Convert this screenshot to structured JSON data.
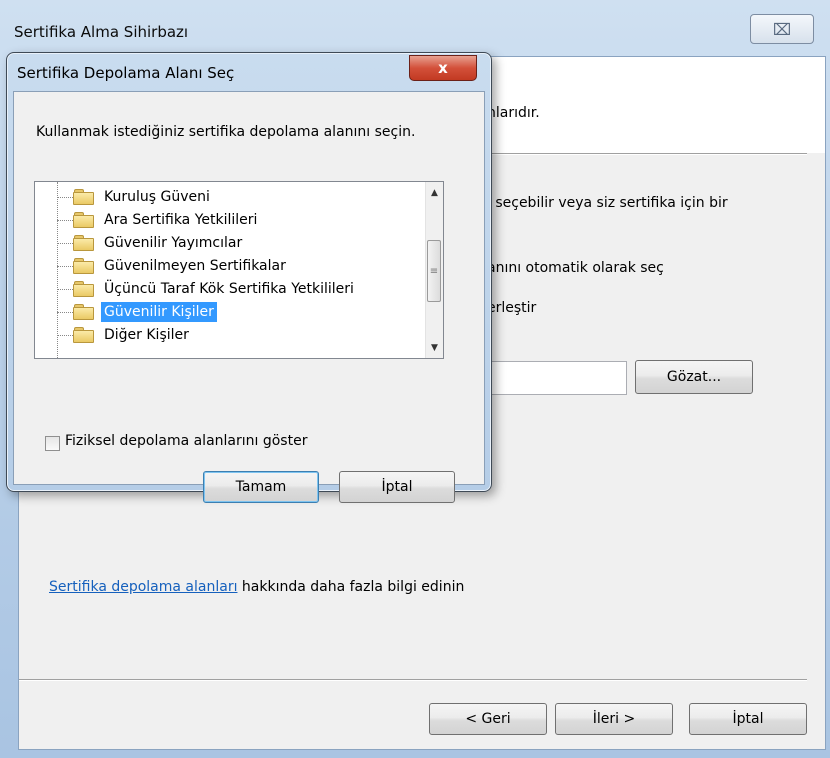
{
  "wizard": {
    "title": "Sertifika Alma Sihirbazı",
    "close_glyph": "⌧",
    "partial_intro": "nlarıdır.",
    "partial_choose": "ı seçebilir veya siz sertifika için bir",
    "partial_auto": "anını otomatik olarak seç",
    "partial_place": "erleştir",
    "browse_label": "Gözat...",
    "link_text": "Sertifika depolama alanları",
    "link_suffix": " hakkında daha fazla bilgi edinin",
    "back_label": "< Geri",
    "next_label": "İleri >",
    "cancel_label": "İptal"
  },
  "dialog": {
    "title": "Sertifika Depolama Alanı Seç",
    "close_glyph": "x",
    "instruction": "Kullanmak istediğiniz sertifika depolama alanını seçin.",
    "tree_items": [
      {
        "label": "Kuruluş Güveni",
        "selected": false
      },
      {
        "label": "Ara Sertifika Yetkilileri",
        "selected": false
      },
      {
        "label": "Güvenilir Yayımcılar",
        "selected": false
      },
      {
        "label": "Güvenilmeyen Sertifikalar",
        "selected": false
      },
      {
        "label": "Üçüncü Taraf Kök Sertifika Yetkilileri",
        "selected": false
      },
      {
        "label": "Güvenilir Kişiler",
        "selected": true
      },
      {
        "label": "Diğer Kişiler",
        "selected": false
      }
    ],
    "show_physical_label": "Fiziksel depolama alanlarını göster",
    "show_physical_checked": false,
    "ok_label": "Tamam",
    "cancel_label": "İptal"
  }
}
